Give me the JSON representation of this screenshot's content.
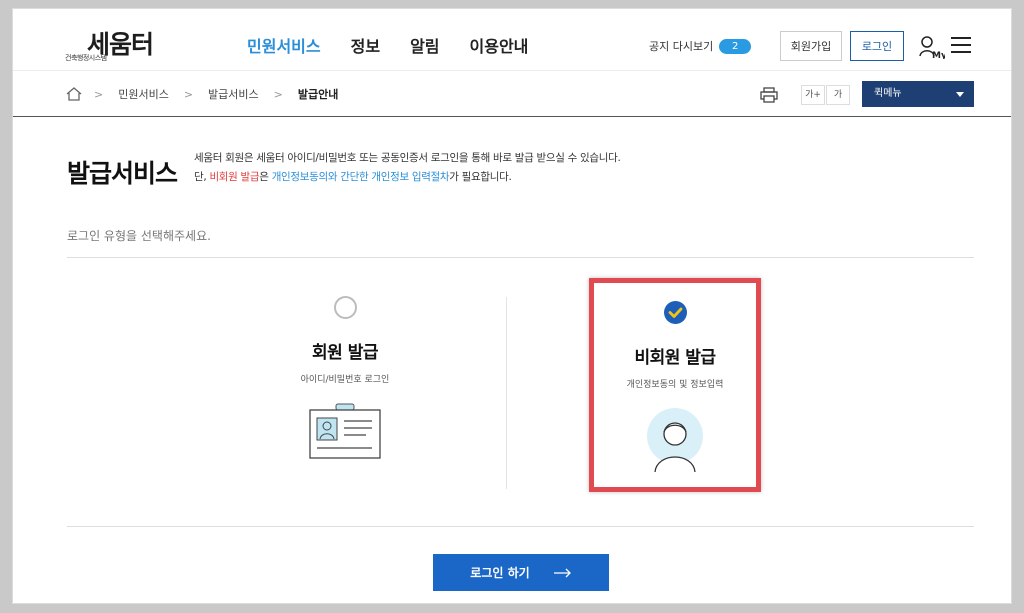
{
  "header": {
    "logo_text": "세움터",
    "logo_sub": "건축행정시스템",
    "gnb": [
      {
        "label": "민원서비스"
      },
      {
        "label": "정보"
      },
      {
        "label": "알림"
      },
      {
        "label": "이용안내"
      }
    ],
    "notice_label": "공지 다시보기",
    "notice_count": "2",
    "join_label": "회원가입",
    "login_label": "로그인",
    "my_label": "My"
  },
  "breadcrumb": {
    "items": [
      "민원서비스",
      "발급서비스",
      "발급안내"
    ]
  },
  "tools": {
    "font_up": "가+",
    "font_down": "가",
    "quick_menu": "퀵메뉴"
  },
  "main": {
    "title": "발급서비스",
    "desc_line1": "세움터 회원은 세움터 아이디/비밀번호 또는 공동인증서 로그인을 통해 바로 발급 받으실 수 있습니다.",
    "desc_line2_a": "단, ",
    "desc_line2_b": "비회원 발급",
    "desc_line2_c": "은 ",
    "desc_line2_d": "개인정보동의와 간단한 개인정보 입력절차",
    "desc_line2_e": "가 필요합니다.",
    "select_label": "로그인 유형을 선택해주세요.",
    "options": [
      {
        "title": "회원 발급",
        "sub": "아이디/비밀번호 로그인",
        "selected": false
      },
      {
        "title": "비회원 발급",
        "sub": "개인정보동의 및 정보입력",
        "selected": true
      }
    ],
    "login_button": "로그인 하기"
  },
  "colors": {
    "accent": "#2a8fd8",
    "primary_button": "#1a67c7",
    "quick_menu_bg": "#1e3f73",
    "highlight_border": "#e14a50"
  }
}
